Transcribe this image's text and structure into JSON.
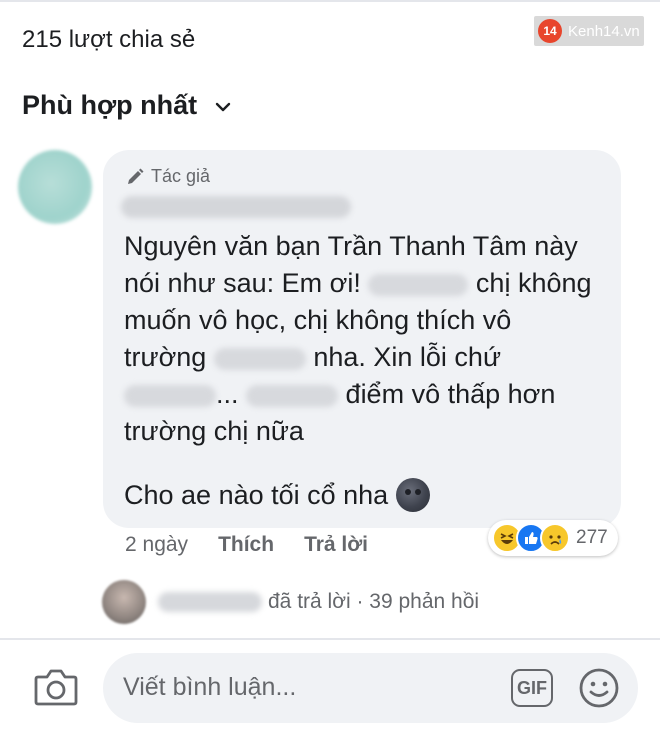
{
  "header": {
    "shares_text": "215 lượt chia sẻ",
    "watermark": {
      "badge": "14",
      "text": "Kenh14.vn"
    },
    "sort_label": "Phù hợp nhất"
  },
  "comment": {
    "author_tag": "Tác giả",
    "author_name": "Hutech Confessions",
    "lines": [
      "Nguyên văn bạn Trần Thanh Tâm này",
      "nói như sau: Em ơi!",
      "chị không",
      "muốn vô học, chị không thích vô",
      "trường",
      "nha. Xin lỗi chứ",
      "...",
      "điểm vô thấp hơn",
      "trường chị nữa"
    ],
    "second_paragraph": "Cho ae nào tối cổ nha",
    "emoji_icon": "new-moon-face-icon",
    "time": "2 ngày",
    "like_label": "Thích",
    "reply_label": "Trả lời",
    "reactions": {
      "icons": [
        "haha-reaction-icon",
        "like-reaction-icon",
        "sad-reaction-icon"
      ],
      "count": "277"
    }
  },
  "reply_summary": {
    "name": "Trà Giang",
    "text": "đã trả lời · 39 phản hồi"
  },
  "composer": {
    "placeholder": "Viết bình luận...",
    "gif_label": "GIF",
    "camera_icon": "camera-icon",
    "emoji_icon": "smiley-icon"
  }
}
